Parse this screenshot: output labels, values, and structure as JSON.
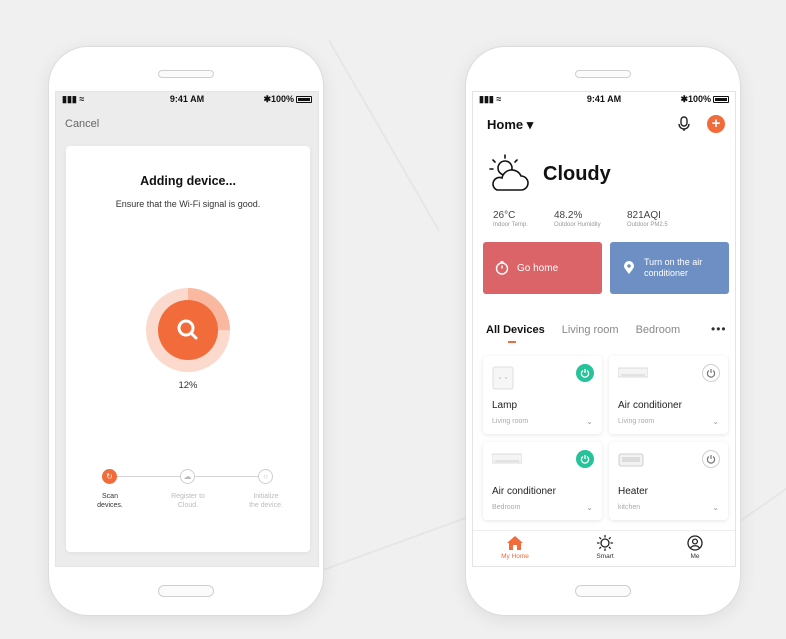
{
  "status_bar": {
    "signal": "▮▮▮ ≈",
    "time": "9:41 AM",
    "battery": "✱100%"
  },
  "adding_screen": {
    "cancel": "Cancel",
    "title": "Adding device...",
    "subtitle": "Ensure that the Wi-Fi signal is good.",
    "progress_value": 0.12,
    "progress_text": "12%",
    "steps": [
      {
        "label": "Scan\ndevices.",
        "state": "active"
      },
      {
        "label": "Register to\nCloud.",
        "state": "inactive"
      },
      {
        "label": "Initialize\nthe device.",
        "state": "inactive"
      }
    ]
  },
  "home_screen": {
    "home_title": "Home ▾",
    "add_label": "+",
    "weather": {
      "label": "Cloudy",
      "stats": [
        {
          "value": "26°C",
          "label": "Indoor Temp."
        },
        {
          "value": "48.2%",
          "label": "Outdoor Humidity"
        },
        {
          "value": "821AQI",
          "label": "Outdoor PM2.5"
        }
      ]
    },
    "scenes": [
      {
        "label": "Go home",
        "color": "#db6468"
      },
      {
        "label": "Turn on the air conditioner",
        "color": "#6d8fc4"
      }
    ],
    "tabs": [
      {
        "label": "All Devices",
        "active": true
      },
      {
        "label": "Living room",
        "active": false
      },
      {
        "label": "Bedroom",
        "active": false
      }
    ],
    "more": "•••",
    "devices": [
      {
        "name": "Lamp",
        "room": "Living room",
        "power": "on"
      },
      {
        "name": "Air conditioner",
        "room": "Living room",
        "power": "off"
      },
      {
        "name": "Air conditioner",
        "room": "Bedroom",
        "power": "on"
      },
      {
        "name": "Heater",
        "room": "kitchen",
        "power": "off"
      }
    ],
    "chevron": "⌄",
    "nav": [
      {
        "label": "My Home",
        "active": true
      },
      {
        "label": "Smart",
        "active": false
      },
      {
        "label": "Me",
        "active": false
      }
    ]
  },
  "colors": {
    "accent": "#f26b3a",
    "power_on": "#26c39a",
    "go_home": "#db6468",
    "air_scene": "#6d8fc4"
  }
}
